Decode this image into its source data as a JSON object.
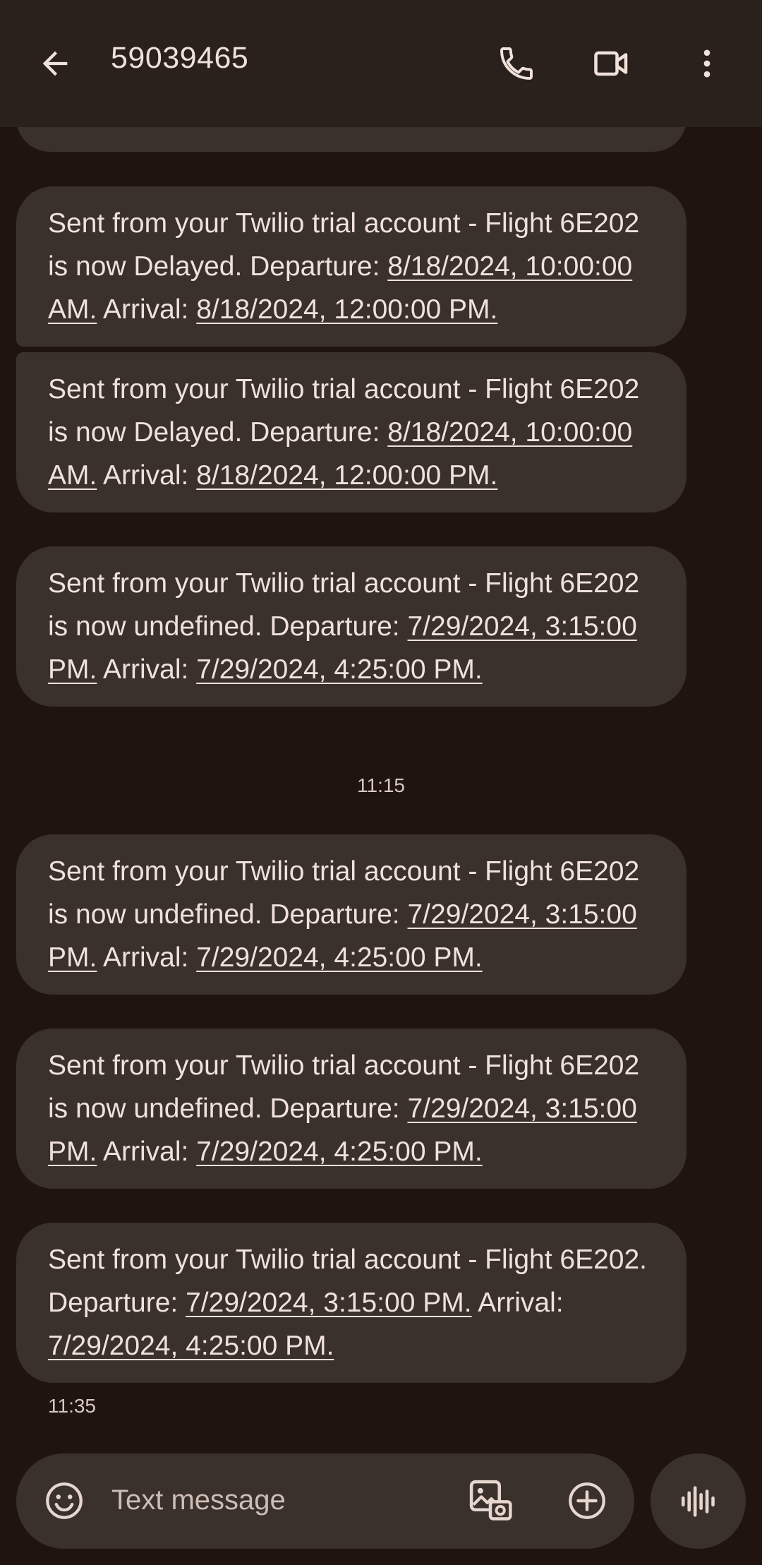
{
  "header": {
    "title": "59039465",
    "back_icon": "arrow-left-icon",
    "call_icon": "phone-icon",
    "video_icon": "video-camera-icon",
    "more_icon": "more-vertical-icon"
  },
  "messages": [
    {
      "p1": "Sent from your Twilio trial account - Flight 6E202 is now Delayed. Departure: ",
      "l1": "8/18/2024, 10:00:00 AM.",
      "p2": " Arrival: ",
      "l2": "8/18/2024, 12:00:00 PM."
    },
    {
      "p1": "Sent from your Twilio trial account - Flight 6E202 is now Delayed. Departure: ",
      "l1": "8/18/2024, 10:00:00 AM.",
      "p2": " Arrival: ",
      "l2": "8/18/2024, 12:00:00 PM."
    },
    {
      "p1": "Sent from your Twilio trial account - Flight 6E202 is now undefined. Departure: ",
      "l1": "7/29/2024, 3:15:00 PM.",
      "p2": " Arrival: ",
      "l2": "7/29/2024, 4:25:00 PM."
    },
    {
      "p1": "Sent from your Twilio trial account - Flight 6E202 is now undefined. Departure: ",
      "l1": "7/29/2024, 3:15:00 PM.",
      "p2": " Arrival: ",
      "l2": "7/29/2024, 4:25:00 PM."
    },
    {
      "p1": "Sent from your Twilio trial account - Flight 6E202 is now undefined. Departure: ",
      "l1": "7/29/2024, 3:15:00 PM.",
      "p2": " Arrival: ",
      "l2": "7/29/2024, 4:25:00 PM."
    },
    {
      "p1": "Sent from your Twilio trial account - Flight 6E202. Departure: ",
      "l1": "7/29/2024, 3:15:00 PM.",
      "p2": " Arrival: ",
      "l2": "7/29/2024, 4:25:00 PM."
    }
  ],
  "timestamps": {
    "divider": "11:15",
    "last": "11:35"
  },
  "compose": {
    "placeholder": "Text message",
    "emoji_icon": "emoji-icon",
    "gallery_icon": "gallery-icon",
    "add_icon": "add-circle-icon",
    "voice_icon": "voice-waveform-icon"
  },
  "colors": {
    "background": "#1f140f",
    "header": "#2a201c",
    "bubble": "#3a302c",
    "text": "#f0e2da"
  }
}
